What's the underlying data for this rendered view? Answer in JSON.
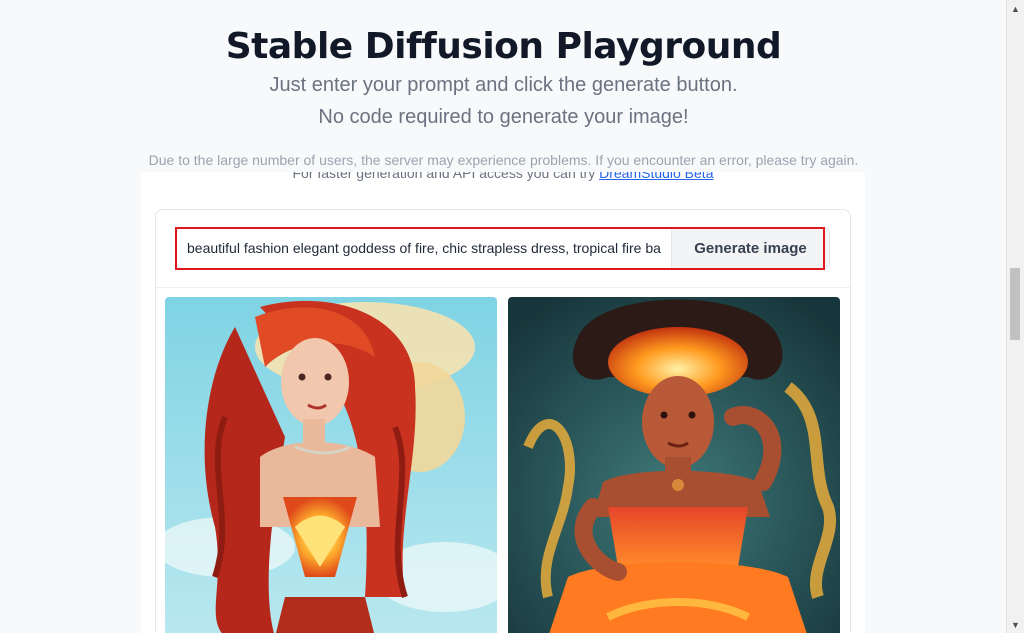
{
  "page": {
    "title": "Stable Diffusion Playground",
    "subtitle_line1": "Just enter your prompt and click the generate button.",
    "subtitle_line2": "No code required to generate your image!",
    "notice": "Due to the large number of users, the server may experience problems. If you encounter an error, please try again.",
    "api_text": "For faster generation and API access you can try ",
    "api_link": "DreamStudio Beta"
  },
  "generator": {
    "prompt_value": "beautiful fashion elegant goddess of fire, chic strapless dress, tropical fire background",
    "generate_label": "Generate image"
  },
  "colors": {
    "highlight": "#e0161f",
    "link": "#2563eb"
  },
  "icons": {
    "scroll_up": "scroll-up-arrow-icon",
    "scroll_down": "scroll-down-arrow-icon"
  }
}
